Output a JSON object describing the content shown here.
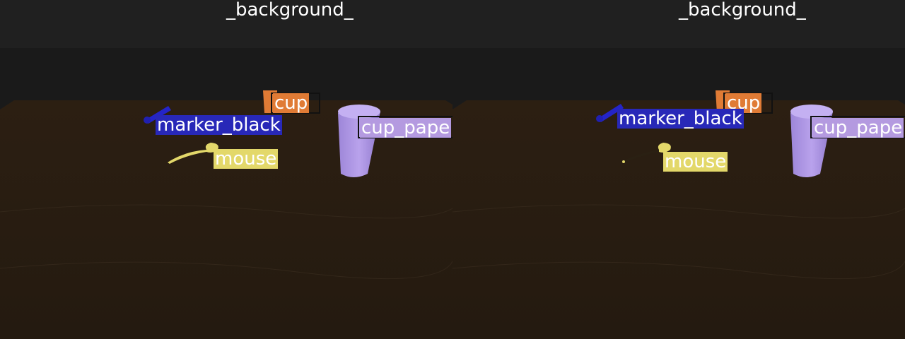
{
  "left_view": {
    "title": "_background_",
    "labels": {
      "cup": "cup",
      "marker_black": "marker_black",
      "mouse": "mouse",
      "cup_paper": "cup_pape"
    }
  },
  "right_view": {
    "title": "_background_",
    "labels": {
      "cup": "cup",
      "marker_black": "marker_black",
      "mouse": "mouse",
      "cup_paper": "cup_pape"
    }
  },
  "colors": {
    "cup": "#e07b35",
    "marker_black": "#2828b8",
    "mouse": "#e3d86a",
    "cup_paper": "#b49ae0",
    "background_band": "#202020",
    "table": "#2f2418"
  }
}
